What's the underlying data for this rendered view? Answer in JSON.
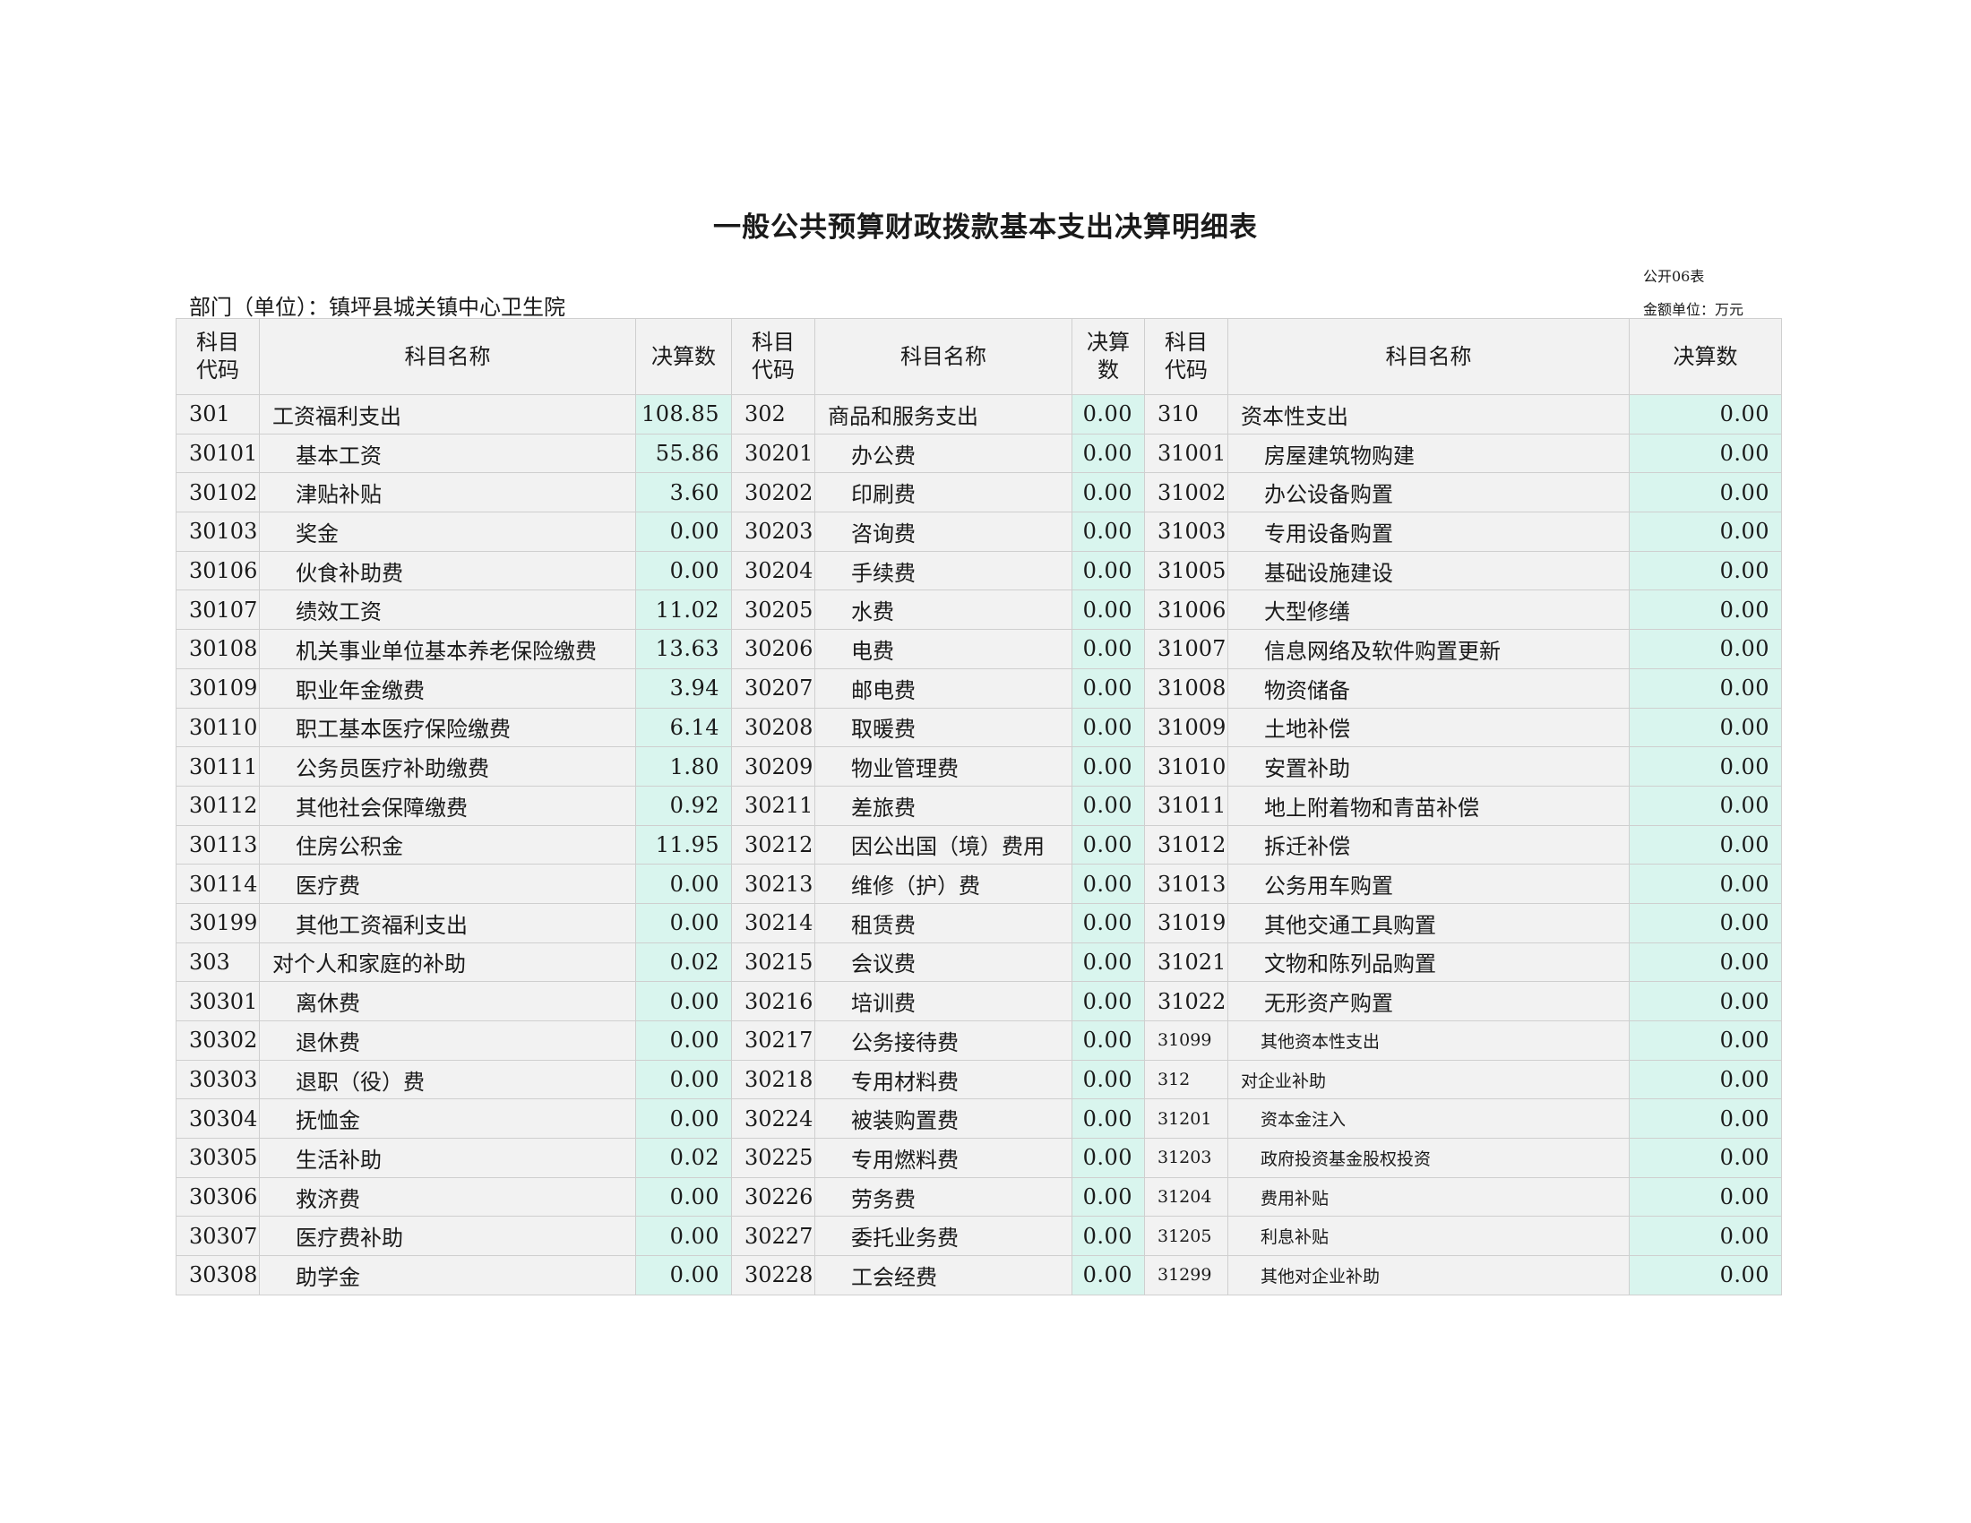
{
  "title": "一般公共预算财政拨款基本支出决算明细表",
  "table_no": "公开06表",
  "unit": "金额单位：万元",
  "department": "部门（单位）：镇坪县城关镇中心卫生院",
  "headers": {
    "code": "科目\n代码",
    "name": "科目名称",
    "amount_wide": "决算数",
    "amount_narrow": "决算\n数"
  },
  "rows": [
    {
      "c1": "301",
      "n1": "工资福利支出",
      "v1": "108.85",
      "c2": "302",
      "n2": "商品和服务支出",
      "v2": "0.00",
      "c3": "310",
      "n3": "资本性支出",
      "v3": "0.00"
    },
    {
      "c1": "30101",
      "n1": "基本工资",
      "v1": "55.86",
      "c2": "30201",
      "n2": "办公费",
      "v2": "0.00",
      "c3": "31001",
      "n3": "房屋建筑物购建",
      "v3": "0.00"
    },
    {
      "c1": "30102",
      "n1": "津贴补贴",
      "v1": "3.60",
      "c2": "30202",
      "n2": "印刷费",
      "v2": "0.00",
      "c3": "31002",
      "n3": "办公设备购置",
      "v3": "0.00"
    },
    {
      "c1": "30103",
      "n1": "奖金",
      "v1": "0.00",
      "c2": "30203",
      "n2": "咨询费",
      "v2": "0.00",
      "c3": "31003",
      "n3": "专用设备购置",
      "v3": "0.00"
    },
    {
      "c1": "30106",
      "n1": "伙食补助费",
      "v1": "0.00",
      "c2": "30204",
      "n2": "手续费",
      "v2": "0.00",
      "c3": "31005",
      "n3": "基础设施建设",
      "v3": "0.00"
    },
    {
      "c1": "30107",
      "n1": "绩效工资",
      "v1": "11.02",
      "c2": "30205",
      "n2": "水费",
      "v2": "0.00",
      "c3": "31006",
      "n3": "大型修缮",
      "v3": "0.00"
    },
    {
      "c1": "30108",
      "n1": "机关事业单位基本养老保险缴费",
      "v1": "13.63",
      "c2": "30206",
      "n2": "电费",
      "v2": "0.00",
      "c3": "31007",
      "n3": "信息网络及软件购置更新",
      "v3": "0.00"
    },
    {
      "c1": "30109",
      "n1": "职业年金缴费",
      "v1": "3.94",
      "c2": "30207",
      "n2": "邮电费",
      "v2": "0.00",
      "c3": "31008",
      "n3": "物资储备",
      "v3": "0.00"
    },
    {
      "c1": "30110",
      "n1": "职工基本医疗保险缴费",
      "v1": "6.14",
      "c2": "30208",
      "n2": "取暖费",
      "v2": "0.00",
      "c3": "31009",
      "n3": "土地补偿",
      "v3": "0.00"
    },
    {
      "c1": "30111",
      "n1": "公务员医疗补助缴费",
      "v1": "1.80",
      "c2": "30209",
      "n2": "物业管理费",
      "v2": "0.00",
      "c3": "31010",
      "n3": "安置补助",
      "v3": "0.00"
    },
    {
      "c1": "30112",
      "n1": "其他社会保障缴费",
      "v1": "0.92",
      "c2": "30211",
      "n2": "差旅费",
      "v2": "0.00",
      "c3": "31011",
      "n3": "地上附着物和青苗补偿",
      "v3": "0.00"
    },
    {
      "c1": "30113",
      "n1": "住房公积金",
      "v1": "11.95",
      "c2": "30212",
      "n2": "因公出国（境）费用",
      "v2": "0.00",
      "c3": "31012",
      "n3": "拆迁补偿",
      "v3": "0.00"
    },
    {
      "c1": "30114",
      "n1": "医疗费",
      "v1": "0.00",
      "c2": "30213",
      "n2": "维修（护）费",
      "v2": "0.00",
      "c3": "31013",
      "n3": "公务用车购置",
      "v3": "0.00"
    },
    {
      "c1": "30199",
      "n1": "其他工资福利支出",
      "v1": "0.00",
      "c2": "30214",
      "n2": "租赁费",
      "v2": "0.00",
      "c3": "31019",
      "n3": "其他交通工具购置",
      "v3": "0.00"
    },
    {
      "c1": "303",
      "n1": "对个人和家庭的补助",
      "v1": "0.02",
      "c2": "30215",
      "n2": "会议费",
      "v2": "0.00",
      "c3": "31021",
      "n3": "文物和陈列品购置",
      "v3": "0.00"
    },
    {
      "c1": "30301",
      "n1": "离休费",
      "v1": "0.00",
      "c2": "30216",
      "n2": "培训费",
      "v2": "0.00",
      "c3": "31022",
      "n3": "无形资产购置",
      "v3": "0.00"
    },
    {
      "c1": "30302",
      "n1": "退休费",
      "v1": "0.00",
      "c2": "30217",
      "n2": "公务接待费",
      "v2": "0.00",
      "c3": "31099",
      "n3": "其他资本性支出",
      "v3": "0.00"
    },
    {
      "c1": "30303",
      "n1": "退职（役）费",
      "v1": "0.00",
      "c2": "30218",
      "n2": "专用材料费",
      "v2": "0.00",
      "c3": "312",
      "n3": "对企业补助",
      "v3": "0.00"
    },
    {
      "c1": "30304",
      "n1": "抚恤金",
      "v1": "0.00",
      "c2": "30224",
      "n2": "被装购置费",
      "v2": "0.00",
      "c3": "31201",
      "n3": "资本金注入",
      "v3": "0.00"
    },
    {
      "c1": "30305",
      "n1": "生活补助",
      "v1": "0.02",
      "c2": "30225",
      "n2": "专用燃料费",
      "v2": "0.00",
      "c3": "31203",
      "n3": "政府投资基金股权投资",
      "v3": "0.00"
    },
    {
      "c1": "30306",
      "n1": "救济费",
      "v1": "0.00",
      "c2": "30226",
      "n2": "劳务费",
      "v2": "0.00",
      "c3": "31204",
      "n3": "费用补贴",
      "v3": "0.00"
    },
    {
      "c1": "30307",
      "n1": "医疗费补助",
      "v1": "0.00",
      "c2": "30227",
      "n2": "委托业务费",
      "v2": "0.00",
      "c3": "31205",
      "n3": "利息补贴",
      "v3": "0.00"
    },
    {
      "c1": "30308",
      "n1": "助学金",
      "v1": "0.00",
      "c2": "30228",
      "n2": "工会经费",
      "v2": "0.00",
      "c3": "31299",
      "n3": "其他对企业补助",
      "v3": "0.00"
    }
  ]
}
